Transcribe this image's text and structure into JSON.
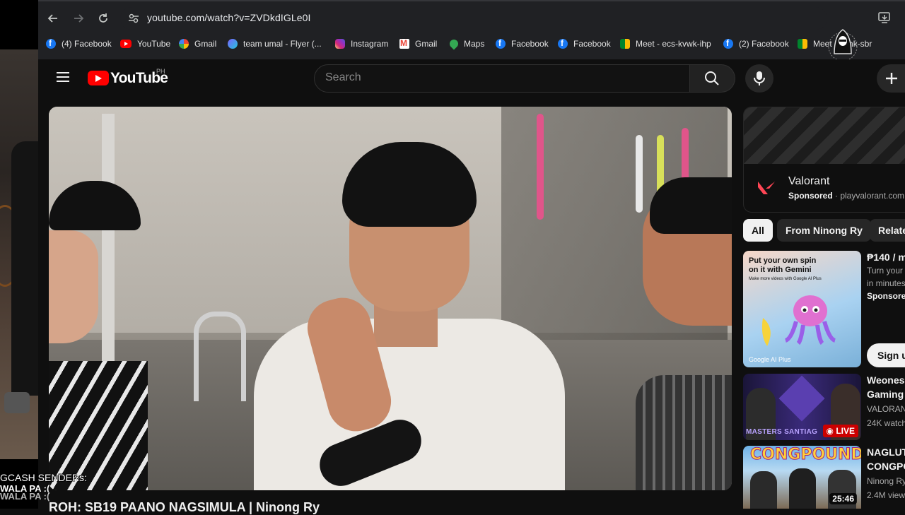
{
  "overlay": {
    "gcash_title": "GCASH SENDERs:",
    "gcash_line1": "WALA PA :(",
    "gcash_line2": "WALA PA :("
  },
  "browser": {
    "url": "youtube.com/watch?v=ZVDkdIGLe0I",
    "bookmarks": [
      {
        "label": "(4) Facebook",
        "icon": "facebook-icon"
      },
      {
        "label": "YouTube",
        "icon": "youtube-icon"
      },
      {
        "label": "Gmail",
        "icon": "google-icon"
      },
      {
        "label": "team umal - Flyer (...",
        "icon": "canva-icon"
      },
      {
        "label": "Instagram",
        "icon": "instagram-icon"
      },
      {
        "label": "Gmail",
        "icon": "gmail-icon"
      },
      {
        "label": "Maps",
        "icon": "maps-icon"
      },
      {
        "label": "Facebook",
        "icon": "facebook-icon"
      },
      {
        "label": "Facebook",
        "icon": "facebook-icon"
      },
      {
        "label": "Meet - ecs-kvwk-ihp",
        "icon": "meet-icon"
      },
      {
        "label": "(2) Facebook",
        "icon": "facebook-icon"
      },
      {
        "label": "Meet - dxnk-sbr",
        "icon": "meet-icon"
      }
    ]
  },
  "youtube": {
    "logo_text": "YouTube",
    "country_code": "PH",
    "search_placeholder": "Search",
    "video_title": "ROH: SB19 PAANO NAGSIMULA | Ninong Ry"
  },
  "sidebar": {
    "ad": {
      "name": "Valorant",
      "sponsored": "Sponsored",
      "domain": "playvalorant.com"
    },
    "chips": [
      "All",
      "From Ninong Ry",
      "Related"
    ],
    "items": [
      {
        "title": "₱140 / m",
        "line1": "Turn your v",
        "line2": "in minutes",
        "sponsored": "Sponsored",
        "button": "Sign u",
        "thumb_caption1": "Put your own spin",
        "thumb_caption2": "on it with Gemini",
        "thumb_caption3": "Make more videos with Google AI Plus",
        "thumb_brand": "Google AI Plus"
      },
      {
        "title1": "Weones I",
        "title2": "Gaming -",
        "channel": "VALORANT",
        "views": "24K watch",
        "badge": "LIVE",
        "thumb_text": "MASTERS SANTIAG"
      },
      {
        "title1": "NAGLUTO",
        "title2": "CONGPO",
        "channel": "Ninong Ry",
        "views": "2.4M view",
        "duration": "25:46",
        "thumb_text": "CONGPOUND"
      }
    ]
  },
  "colors": {
    "yt_red": "#ff0000",
    "background": "#0f0f0f",
    "chip_active": "#f1f1f1"
  }
}
